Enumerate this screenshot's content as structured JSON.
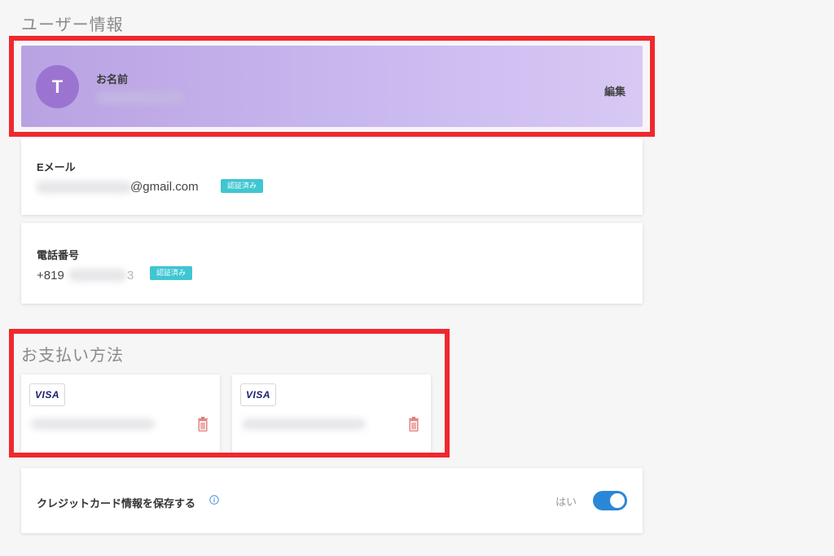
{
  "user_section": {
    "title": "ユーザー情報",
    "name_card": {
      "avatar_letter": "T",
      "label": "お名前",
      "edit_label": "編集"
    },
    "email_card": {
      "label": "Eメール",
      "value_suffix": "@gmail.com",
      "badge": "認証済み"
    },
    "phone_card": {
      "label": "電話番号",
      "value_prefix": "+819",
      "value_suffix": "3",
      "badge": "認証済み"
    }
  },
  "payment_section": {
    "title": "お支払い方法",
    "cards": [
      {
        "brand": "VISA"
      },
      {
        "brand": "VISA"
      }
    ]
  },
  "save_card": {
    "label": "クレジットカード情報を保存する",
    "toggle_text": "はい",
    "toggle_on": true
  },
  "colors": {
    "highlight": "#f0282d",
    "accent_blue": "#2a87d8",
    "badge_teal": "#3fc6d1",
    "avatar_purple": "#9b74d1",
    "trash_red": "#e07a7a"
  }
}
